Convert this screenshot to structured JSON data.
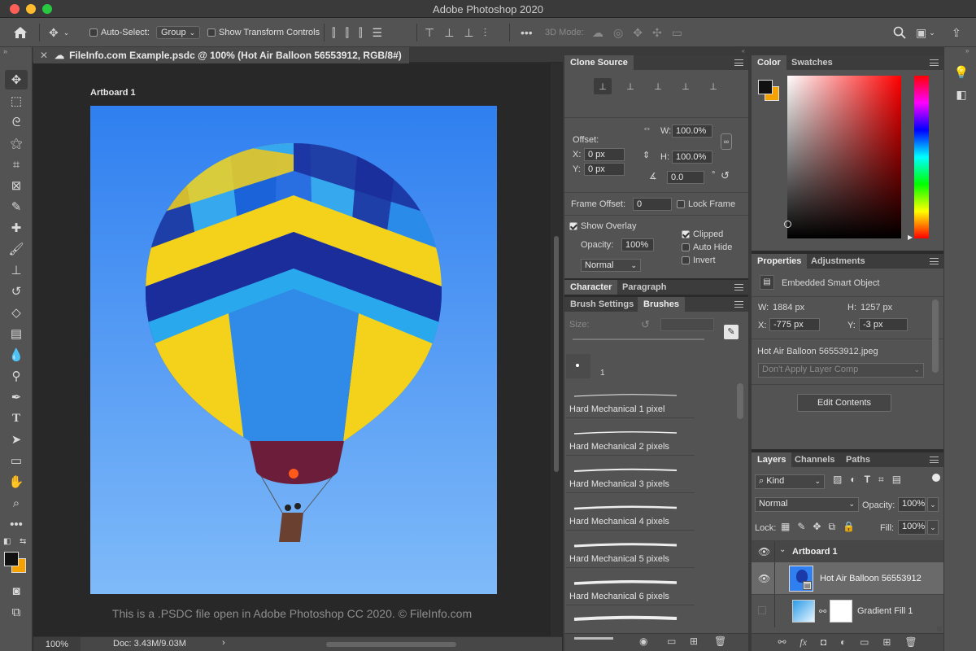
{
  "window": {
    "title": "Adobe Photoshop 2020"
  },
  "options_bar": {
    "auto_select_label": "Auto-Select:",
    "auto_select_value": "Group",
    "show_transform_label": "Show Transform Controls",
    "mode_3d_label": "3D Mode:"
  },
  "document": {
    "tab_title": "FileInfo.com Example.psdc @ 100% (Hot Air Balloon 56553912, RGB/8#)",
    "artboard_label": "Artboard 1",
    "caption": "This is a .PSDC file open in Adobe Photoshop CC 2020. © FileInfo.com",
    "zoom": "100%",
    "doc_size": "Doc: 3.43M/9.03M"
  },
  "clone_source": {
    "tab": "Clone Source",
    "offset_label": "Offset:",
    "x_label": "X:",
    "x_value": "0 px",
    "y_label": "Y:",
    "y_value": "0 px",
    "w_label": "W:",
    "w_value": "100.0%",
    "h_label": "H:",
    "h_value": "100.0%",
    "angle_value": "0.0",
    "angle_unit": "°",
    "frame_offset_label": "Frame Offset:",
    "frame_offset_value": "0",
    "lock_frame_label": "Lock Frame",
    "show_overlay_label": "Show Overlay",
    "opacity_label": "Opacity:",
    "opacity_value": "100%",
    "blend_value": "Normal",
    "clipped_label": "Clipped",
    "auto_hide_label": "Auto Hide",
    "invert_label": "Invert"
  },
  "char_tabs": {
    "character": "Character",
    "paragraph": "Paragraph"
  },
  "brush_tabs": {
    "brush_settings": "Brush Settings",
    "brushes": "Brushes"
  },
  "brushes": {
    "size_label": "Size:",
    "preset_number": "1",
    "items": [
      {
        "name": "Hard Mechanical 1 pixel"
      },
      {
        "name": "Hard Mechanical 2 pixels"
      },
      {
        "name": "Hard Mechanical 3 pixels"
      },
      {
        "name": "Hard Mechanical 4 pixels"
      },
      {
        "name": "Hard Mechanical 5 pixels"
      },
      {
        "name": "Hard Mechanical 6 pixels"
      }
    ]
  },
  "color_panel": {
    "tab_color": "Color",
    "tab_swatches": "Swatches",
    "foreground": "#111111",
    "background": "#f5a100"
  },
  "properties": {
    "tab_properties": "Properties",
    "tab_adjustments": "Adjustments",
    "type_label": "Embedded Smart Object",
    "w_label": "W:",
    "w_value": "1884 px",
    "h_label": "H:",
    "h_value": "1257 px",
    "x_label": "X:",
    "x_value": "-775 px",
    "y_label": "Y:",
    "y_value": "-3 px",
    "filename": "Hot Air Balloon 56553912.jpeg",
    "layer_comp": "Don't Apply Layer Comp",
    "edit_contents": "Edit Contents"
  },
  "layers": {
    "tab_layers": "Layers",
    "tab_channels": "Channels",
    "tab_paths": "Paths",
    "kind_label": "Kind",
    "blend_mode": "Normal",
    "opacity_label": "Opacity:",
    "opacity_value": "100%",
    "lock_label": "Lock:",
    "fill_label": "Fill:",
    "fill_value": "100%",
    "items": [
      {
        "name": "Artboard 1"
      },
      {
        "name": "Hot Air Balloon 56553912"
      },
      {
        "name": "Gradient Fill 1"
      }
    ]
  }
}
